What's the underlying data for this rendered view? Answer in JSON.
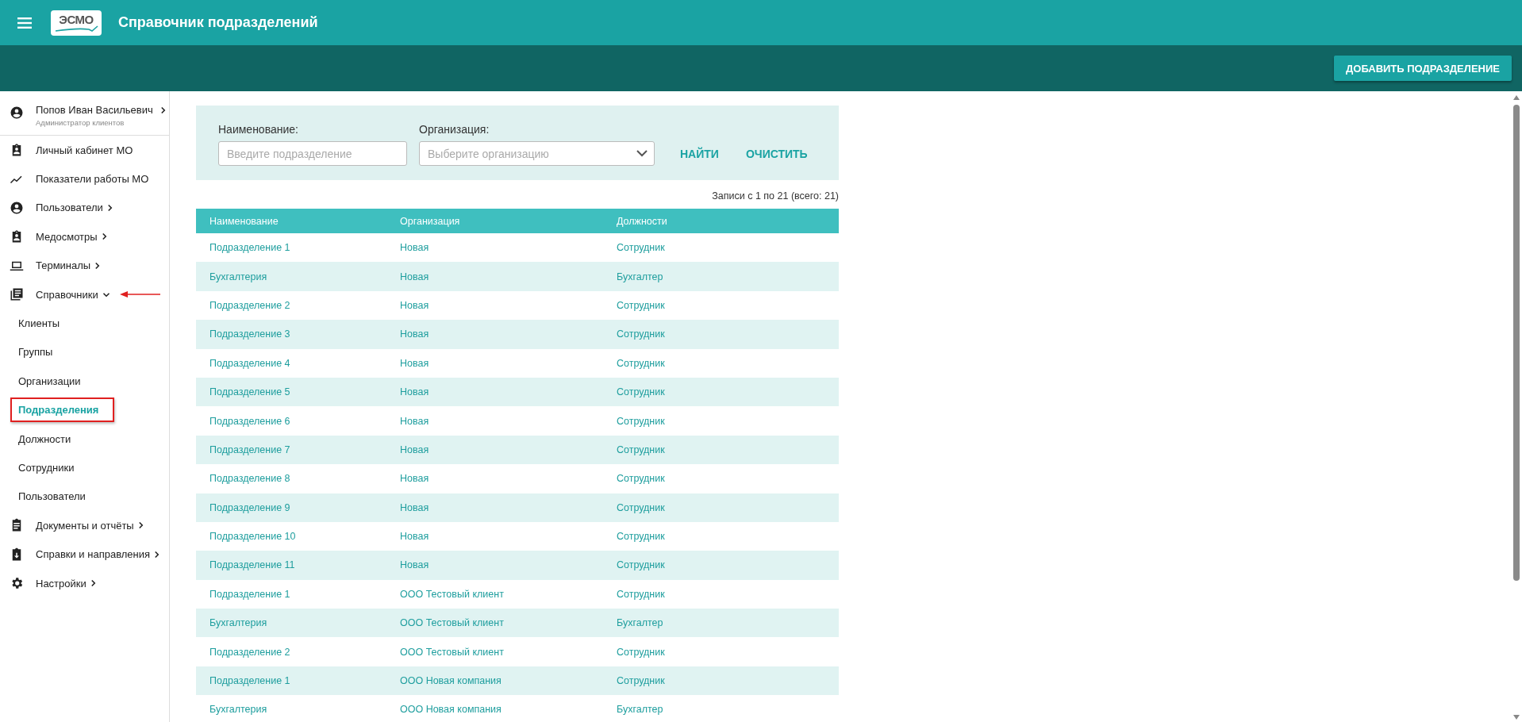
{
  "header": {
    "title": "Справочник подразделений",
    "logo_text": "ЭСМО"
  },
  "toolbar": {
    "add_button": "ДОБАВИТЬ ПОДРАЗДЕЛЕНИЕ"
  },
  "sidebar": {
    "user": {
      "name": "Попов Иван Васильевич",
      "role": "Администратор клиентов"
    },
    "items": [
      {
        "label": "Личный кабинет МО",
        "has_submenu": false,
        "annotated": false
      },
      {
        "label": "Показатели работы МО",
        "has_submenu": false,
        "annotated": false
      },
      {
        "label": "Пользователи",
        "has_submenu": true,
        "expanded": false,
        "annotated": false
      },
      {
        "label": "Медосмотры",
        "has_submenu": true,
        "expanded": false,
        "annotated": false
      },
      {
        "label": "Терминалы",
        "has_submenu": true,
        "expanded": false,
        "annotated": false
      },
      {
        "label": "Справочники",
        "has_submenu": true,
        "expanded": true,
        "annotated": true,
        "children": [
          {
            "label": "Клиенты",
            "selected": false,
            "annotated": false
          },
          {
            "label": "Группы",
            "selected": false,
            "annotated": false
          },
          {
            "label": "Организации",
            "selected": false,
            "annotated": false
          },
          {
            "label": "Подразделения",
            "selected": true,
            "annotated": true
          },
          {
            "label": "Должности",
            "selected": false,
            "annotated": false
          },
          {
            "label": "Сотрудники",
            "selected": false,
            "annotated": false
          },
          {
            "label": "Пользователи",
            "selected": false,
            "annotated": false
          }
        ]
      },
      {
        "label": "Документы и отчёты",
        "has_submenu": true,
        "expanded": false,
        "annotated": false
      },
      {
        "label": "Справки и направления",
        "has_submenu": true,
        "expanded": false,
        "annotated": false
      },
      {
        "label": "Настройки",
        "has_submenu": true,
        "expanded": false,
        "annotated": false
      }
    ]
  },
  "filters": {
    "name_label": "Наименование:",
    "name_placeholder": "Введите подразделение",
    "org_label": "Организация:",
    "org_placeholder": "Выберите организацию",
    "find_button": "НАЙТИ",
    "clear_button": "ОЧИСТИТЬ"
  },
  "records_info": "Записи с 1 по 21 (всего: 21)",
  "table": {
    "columns": [
      "Наименование",
      "Организация",
      "Должности"
    ],
    "rows": [
      [
        "Подразделение 1",
        "Новая",
        "Сотрудник"
      ],
      [
        "Бухгалтерия",
        "Новая",
        "Бухгалтер"
      ],
      [
        "Подразделение 2",
        "Новая",
        "Сотрудник"
      ],
      [
        "Подразделение 3",
        "Новая",
        "Сотрудник"
      ],
      [
        "Подразделение 4",
        "Новая",
        "Сотрудник"
      ],
      [
        "Подразделение 5",
        "Новая",
        "Сотрудник"
      ],
      [
        "Подразделение 6",
        "Новая",
        "Сотрудник"
      ],
      [
        "Подразделение 7",
        "Новая",
        "Сотрудник"
      ],
      [
        "Подразделение 8",
        "Новая",
        "Сотрудник"
      ],
      [
        "Подразделение 9",
        "Новая",
        "Сотрудник"
      ],
      [
        "Подразделение 10",
        "Новая",
        "Сотрудник"
      ],
      [
        "Подразделение 11",
        "Новая",
        "Сотрудник"
      ],
      [
        "Подразделение 1",
        "ООО Тестовый клиент",
        "Сотрудник"
      ],
      [
        "Бухгалтерия",
        "ООО Тестовый клиент",
        "Бухгалтер"
      ],
      [
        "Подразделение 2",
        "ООО Тестовый клиент",
        "Сотрудник"
      ],
      [
        "Подразделение 1",
        "ООО Новая компания",
        "Сотрудник"
      ],
      [
        "Бухгалтерия",
        "ООО Новая компания",
        "Бухгалтер"
      ]
    ]
  }
}
